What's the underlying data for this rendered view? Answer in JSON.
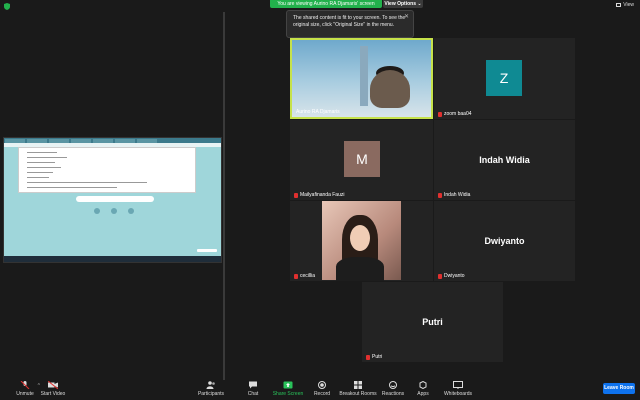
{
  "top": {
    "viewing_label": "You are viewing Aurino RA Djamaris' screen",
    "view_options_label": "View Options ⌄",
    "view_label": "View"
  },
  "tooltip": {
    "text": "The shared content is fit to your screen. To see the original size, click \"Original Size\" in the menu.",
    "close": "✕"
  },
  "tiles": [
    {
      "name": "Aurino RA Djamaris",
      "kind": "video"
    },
    {
      "name": "zoom baa04",
      "kind": "avatar",
      "letter": "Z",
      "color": "#0f8a93"
    },
    {
      "name": "Mailyafinanda Fauzi",
      "kind": "avatar",
      "letter": "M",
      "color": "#8a6a60"
    },
    {
      "name": "Indah Widia",
      "kind": "name",
      "display": "Indah Widia"
    },
    {
      "name": "cecillia",
      "kind": "video"
    },
    {
      "name": "Dwiyanto",
      "kind": "name",
      "display": "Dwiyanto"
    },
    {
      "name": "Putri",
      "kind": "name",
      "display": "Putri"
    }
  ],
  "toolbar": {
    "unmute": "Unmute",
    "start_video": "Start Video",
    "participants": "Participants",
    "participants_count": "7",
    "chat": "Chat",
    "share_screen": "Share Screen",
    "record": "Record",
    "breakout": "Breakout Rooms",
    "reactions": "Reactions",
    "apps": "Apps",
    "whiteboards": "Whiteboards",
    "leave": "Leave Room"
  },
  "colors": {
    "active_border": "#c6e24a",
    "pill_green": "#22b14c",
    "leave_blue": "#0e72ed",
    "mute_red": "#e0302f"
  }
}
